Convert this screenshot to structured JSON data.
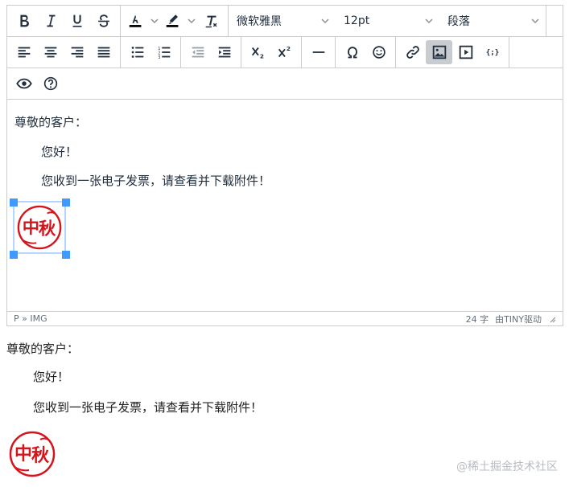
{
  "toolbar": {
    "font_family": "微软雅黑",
    "font_size": "12pt",
    "block_format": "段落",
    "icons": [
      "bold-icon",
      "italic-icon",
      "underline-icon",
      "strikethrough-icon",
      "text-color-icon",
      "highlight-icon",
      "clear-format-icon",
      "align-left-icon",
      "align-center-icon",
      "align-right-icon",
      "align-justify-icon",
      "bullet-list-icon",
      "numbered-list-icon",
      "outdent-icon",
      "indent-icon",
      "subscript-icon",
      "superscript-icon",
      "horizontal-rule-icon",
      "special-char-icon",
      "emoji-icon",
      "link-icon",
      "image-icon",
      "media-icon",
      "code-sample-icon",
      "preview-icon",
      "help-icon"
    ],
    "active_button": "image-button",
    "colors": {
      "text_color_bar": "#000000",
      "highlight_bar": "#000000",
      "active_bg": "#c8cbcf",
      "handle": "#4099ff",
      "selection": "#b4d7ff",
      "seal_red": "#d6141b"
    }
  },
  "editor": {
    "greeting": "尊敬的客户：",
    "hello": "您好！",
    "body": "您收到一张电子发票，请查看并下载附件！",
    "seal_text": [
      "中",
      "秋"
    ]
  },
  "statusbar": {
    "path": "P » IMG",
    "word_count": "24 字",
    "powered_by": "由TINY驱动"
  },
  "preview": {
    "greeting": "尊敬的客户：",
    "hello": "您好！",
    "body": "您收到一张电子发票，请查看并下载附件！"
  },
  "watermark": "@稀土掘金技术社区"
}
